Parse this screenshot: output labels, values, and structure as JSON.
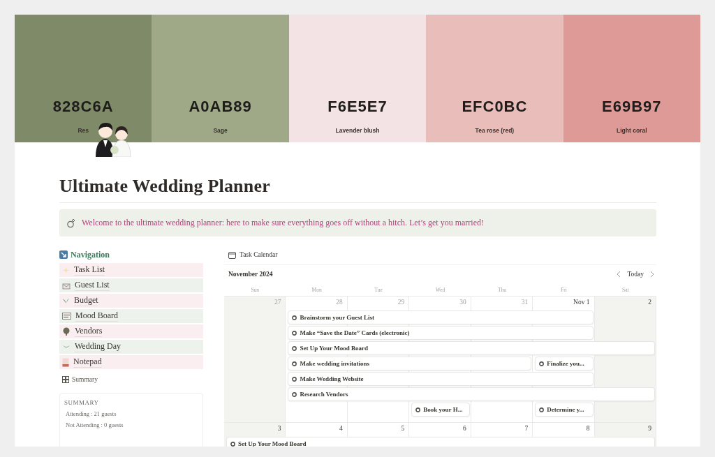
{
  "palette": [
    {
      "hex": "828C6A",
      "name": "Res",
      "color": "#7f8a68"
    },
    {
      "hex": "A0AB89",
      "name": "Sage",
      "color": "#9fa987"
    },
    {
      "hex": "F6E5E7",
      "name": "Lavender blush",
      "color": "#f3e3e5"
    },
    {
      "hex": "EFC0BC",
      "name": "Tea rose (red)",
      "color": "#e9beba"
    },
    {
      "hex": "E69B97",
      "name": "Light coral",
      "color": "#de9a96"
    }
  ],
  "title": "Ultimate Wedding Planner",
  "callout": "Welcome to the ultimate wedding planner: here to make sure everything goes off without a hitch. Let’s get you married!",
  "navigation": {
    "heading": "Navigation",
    "items": [
      {
        "label": "Task List",
        "color": "#fbeef0"
      },
      {
        "label": "Guest List",
        "color": "#eef2ec"
      },
      {
        "label": "Budget",
        "color": "#fbeef0"
      },
      {
        "label": "Mood Board",
        "color": "#eef2ec"
      },
      {
        "label": "Vendors",
        "color": "#fbeef0"
      },
      {
        "label": "Wedding Day",
        "color": "#eef2ec"
      },
      {
        "label": "Notepad",
        "color": "#fbeef0"
      }
    ],
    "summary_link": "Summary"
  },
  "summary": {
    "heading": "SUMMARY",
    "lines": [
      "Attending : 21 guests",
      "Not Attending : 0 guests"
    ]
  },
  "calendar": {
    "title": "Task Calendar",
    "month": "November 2024",
    "today": "Today",
    "weekdays": [
      "Sun",
      "Mon",
      "Tue",
      "Wed",
      "Thu",
      "Fri",
      "Sat"
    ],
    "weeks": [
      {
        "days": [
          {
            "date": "27",
            "muted": true,
            "weekend": true
          },
          {
            "date": "28",
            "muted": true,
            "weekend": false
          },
          {
            "date": "29",
            "muted": true,
            "weekend": false
          },
          {
            "date": "30",
            "muted": true,
            "weekend": false
          },
          {
            "date": "31",
            "muted": true,
            "weekend": false
          },
          {
            "date": "Nov 1",
            "muted": false,
            "weekend": false
          },
          {
            "date": "2",
            "muted": false,
            "weekend": true
          }
        ],
        "rows": [
          [
            {
              "kind": "blank"
            },
            {
              "kind": "event",
              "title": "Brainstorm your Guest List"
            },
            {
              "kind": "more"
            },
            {
              "kind": "more"
            },
            {
              "kind": "more"
            },
            {
              "kind": "more"
            }
          ],
          [
            {
              "kind": "blank"
            },
            {
              "kind": "event",
              "title": "Make “Save the Date” Cards (electronic)"
            },
            {
              "kind": "more"
            },
            {
              "kind": "more"
            },
            {
              "kind": "more"
            },
            {
              "kind": "more"
            }
          ],
          [
            {
              "kind": "blank"
            },
            {
              "kind": "event",
              "title": "Set Up Your Mood Board"
            },
            {
              "kind": "more"
            },
            {
              "kind": "more"
            },
            {
              "kind": "more"
            },
            {
              "kind": "more"
            },
            {
              "kind": "more"
            }
          ],
          [
            {
              "kind": "blank"
            },
            {
              "kind": "event",
              "title": "Make wedding invitations"
            },
            {
              "kind": "more"
            },
            {
              "kind": "more"
            },
            {
              "kind": "more"
            },
            {
              "kind": "event",
              "title": "Finalize you..."
            }
          ],
          [
            {
              "kind": "blank"
            },
            {
              "kind": "event",
              "title": "Make Wedding Website"
            },
            {
              "kind": "more"
            },
            {
              "kind": "more"
            },
            {
              "kind": "more"
            },
            {
              "kind": "more"
            }
          ],
          [
            {
              "kind": "blank"
            },
            {
              "kind": "event",
              "title": "Research Vendors"
            },
            {
              "kind": "more"
            },
            {
              "kind": "more"
            },
            {
              "kind": "more"
            },
            {
              "kind": "more"
            },
            {
              "kind": "more"
            }
          ],
          [
            {
              "kind": "blank"
            },
            {
              "kind": "blank"
            },
            {
              "kind": "blank"
            },
            {
              "kind": "event",
              "title": "Book your H..."
            },
            {
              "kind": "blank"
            },
            {
              "kind": "event",
              "title": "Determine y..."
            }
          ]
        ]
      },
      {
        "days": [
          {
            "date": "3",
            "muted": false,
            "weekend": true
          },
          {
            "date": "4",
            "muted": false,
            "weekend": false
          },
          {
            "date": "5",
            "muted": false,
            "weekend": false
          },
          {
            "date": "6",
            "muted": false,
            "weekend": false
          },
          {
            "date": "7",
            "muted": false,
            "weekend": false
          },
          {
            "date": "8",
            "muted": false,
            "weekend": false
          },
          {
            "date": "9",
            "muted": false,
            "weekend": true
          }
        ],
        "rows": [
          [
            {
              "kind": "event",
              "title": "Set Up Your Mood Board"
            },
            {
              "kind": "more"
            },
            {
              "kind": "more"
            },
            {
              "kind": "more"
            },
            {
              "kind": "more"
            },
            {
              "kind": "more"
            },
            {
              "kind": "more"
            }
          ]
        ]
      }
    ]
  }
}
